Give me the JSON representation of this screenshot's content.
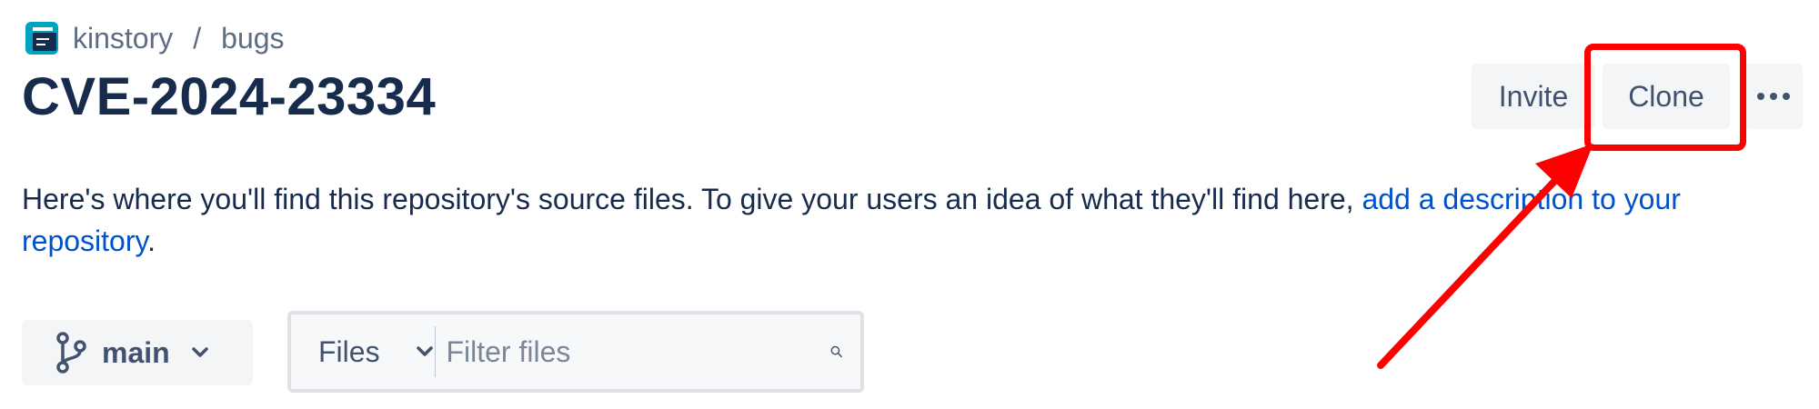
{
  "breadcrumb": {
    "workspace": "kinstory",
    "separator": "/",
    "repository": "bugs"
  },
  "page_title": "CVE-2024-23334",
  "actions": {
    "invite_label": "Invite",
    "clone_label": "Clone",
    "more_icon": "more-horizontal-icon"
  },
  "description": {
    "text": "Here's where you'll find this repository's source files. To give your users an idea of what they'll find here, ",
    "link_text": "add a description to your repository",
    "suffix": "."
  },
  "branch": {
    "selected": "main",
    "icon": "branch-icon"
  },
  "filter": {
    "scope_selected": "Files",
    "placeholder": "Filter files",
    "value": ""
  },
  "annotation": {
    "color": "#ff0000",
    "target": "Clone"
  },
  "colors": {
    "text_primary": "#172b4d",
    "text_secondary": "#5e6c84",
    "link": "#0052cc",
    "button_bg": "#f4f5f7",
    "logo": "#00a3bf"
  }
}
